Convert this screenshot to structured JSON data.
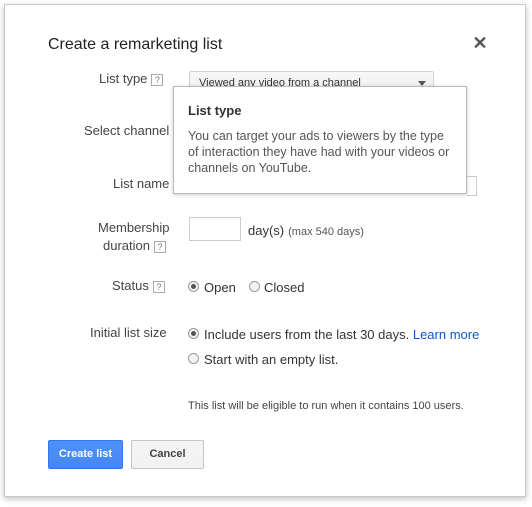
{
  "dialog": {
    "title": "Create a remarketing list",
    "close_symbol": "✕"
  },
  "fields": {
    "list_type_label": "List type",
    "select_channel_label": "Select channel",
    "list_name_label": "List name",
    "membership_label_line1": "Membership",
    "membership_label_line2": "duration",
    "status_label": "Status",
    "initial_size_label": "Initial list size",
    "help_symbol": "?"
  },
  "list_type": {
    "selected": "Viewed any video from a channel"
  },
  "tooltip": {
    "title": "List type",
    "body": "You can target your ads to viewers by the type of interaction they have had with your videos or channels on YouTube."
  },
  "membership": {
    "value": "",
    "unit": "day(s)",
    "max_note": "(max 540 days)"
  },
  "status": {
    "options": [
      "Open",
      "Closed"
    ],
    "selected": "Open"
  },
  "initial_size": {
    "option1": "Include users from the last 30 days.",
    "learn_more": "Learn more",
    "option2": "Start with an empty list.",
    "selected": "option1"
  },
  "note": "This list will be eligible to run when it contains 100 users.",
  "buttons": {
    "create": "Create list",
    "cancel": "Cancel"
  },
  "colors": {
    "primary_button": "#4d90fe",
    "link": "#1155cc"
  }
}
